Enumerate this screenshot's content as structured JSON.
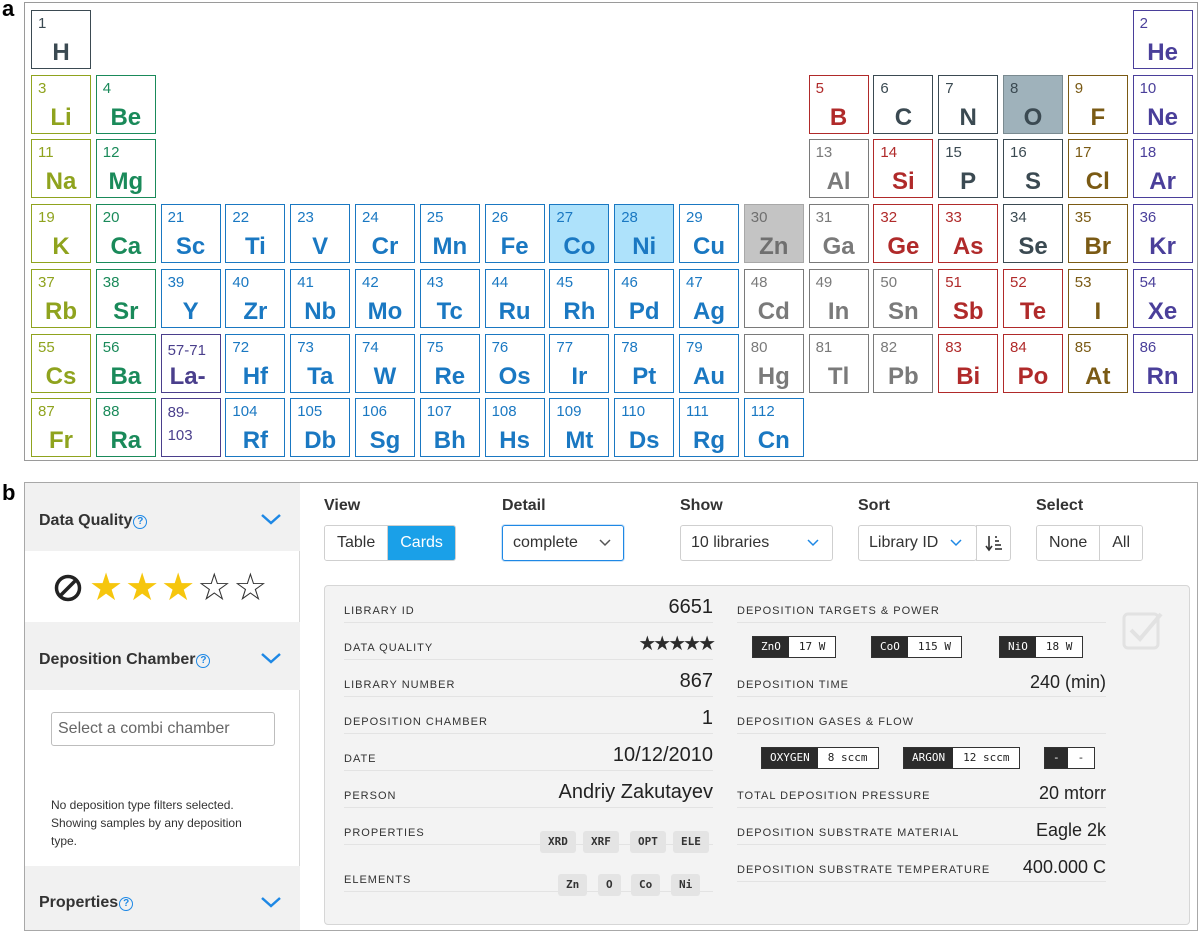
{
  "panel_labels": {
    "a": "a",
    "b": "b"
  },
  "periodic_table": {
    "colors": {
      "alkali": "#8fa31e",
      "alkaline": "#1a8a5a",
      "transition": "#1a78c2",
      "lanthanide": "#4a3f8c",
      "metalloid": "#b02a2a",
      "nonmetal": "#3b4a52",
      "halogen": "#7a5a14",
      "noble": "#4a3f9a",
      "post": "#7a7a7a"
    },
    "elements": [
      {
        "n": "1",
        "s": "H",
        "c": "nonmetal",
        "col": 0,
        "row": 0
      },
      {
        "n": "2",
        "s": "He",
        "c": "noble",
        "col": 17,
        "row": 0
      },
      {
        "n": "3",
        "s": "Li",
        "c": "alkali",
        "col": 0,
        "row": 1
      },
      {
        "n": "4",
        "s": "Be",
        "c": "alkaline",
        "col": 1,
        "row": 1
      },
      {
        "n": "5",
        "s": "B",
        "c": "metalloid",
        "col": 12,
        "row": 1
      },
      {
        "n": "6",
        "s": "C",
        "c": "nonmetal",
        "col": 13,
        "row": 1
      },
      {
        "n": "7",
        "s": "N",
        "c": "nonmetal",
        "col": 14,
        "row": 1
      },
      {
        "n": "8",
        "s": "O",
        "c": "nonmetal",
        "col": 15,
        "row": 1,
        "sel": "dark"
      },
      {
        "n": "9",
        "s": "F",
        "c": "halogen",
        "col": 16,
        "row": 1
      },
      {
        "n": "10",
        "s": "Ne",
        "c": "noble",
        "col": 17,
        "row": 1
      },
      {
        "n": "11",
        "s": "Na",
        "c": "alkali",
        "col": 0,
        "row": 2
      },
      {
        "n": "12",
        "s": "Mg",
        "c": "alkaline",
        "col": 1,
        "row": 2
      },
      {
        "n": "13",
        "s": "Al",
        "c": "post",
        "col": 12,
        "row": 2
      },
      {
        "n": "14",
        "s": "Si",
        "c": "metalloid",
        "col": 13,
        "row": 2
      },
      {
        "n": "15",
        "s": "P",
        "c": "nonmetal",
        "col": 14,
        "row": 2
      },
      {
        "n": "16",
        "s": "S",
        "c": "nonmetal",
        "col": 15,
        "row": 2
      },
      {
        "n": "17",
        "s": "Cl",
        "c": "halogen",
        "col": 16,
        "row": 2
      },
      {
        "n": "18",
        "s": "Ar",
        "c": "noble",
        "col": 17,
        "row": 2
      },
      {
        "n": "19",
        "s": "K",
        "c": "alkali",
        "col": 0,
        "row": 3
      },
      {
        "n": "20",
        "s": "Ca",
        "c": "alkaline",
        "col": 1,
        "row": 3
      },
      {
        "n": "21",
        "s": "Sc",
        "c": "transition",
        "col": 2,
        "row": 3
      },
      {
        "n": "22",
        "s": "Ti",
        "c": "transition",
        "col": 3,
        "row": 3
      },
      {
        "n": "23",
        "s": "V",
        "c": "transition",
        "col": 4,
        "row": 3
      },
      {
        "n": "24",
        "s": "Cr",
        "c": "transition",
        "col": 5,
        "row": 3
      },
      {
        "n": "25",
        "s": "Mn",
        "c": "transition",
        "col": 6,
        "row": 3
      },
      {
        "n": "26",
        "s": "Fe",
        "c": "transition",
        "col": 7,
        "row": 3
      },
      {
        "n": "27",
        "s": "Co",
        "c": "transition",
        "col": 8,
        "row": 3,
        "sel": "blue"
      },
      {
        "n": "28",
        "s": "Ni",
        "c": "transition",
        "col": 9,
        "row": 3,
        "sel": "blue"
      },
      {
        "n": "29",
        "s": "Cu",
        "c": "transition",
        "col": 10,
        "row": 3
      },
      {
        "n": "30",
        "s": "Zn",
        "c": "post",
        "col": 11,
        "row": 3,
        "sel": "gray"
      },
      {
        "n": "31",
        "s": "Ga",
        "c": "post",
        "col": 12,
        "row": 3
      },
      {
        "n": "32",
        "s": "Ge",
        "c": "metalloid",
        "col": 13,
        "row": 3
      },
      {
        "n": "33",
        "s": "As",
        "c": "metalloid",
        "col": 14,
        "row": 3
      },
      {
        "n": "34",
        "s": "Se",
        "c": "nonmetal",
        "col": 15,
        "row": 3
      },
      {
        "n": "35",
        "s": "Br",
        "c": "halogen",
        "col": 16,
        "row": 3
      },
      {
        "n": "36",
        "s": "Kr",
        "c": "noble",
        "col": 17,
        "row": 3
      },
      {
        "n": "37",
        "s": "Rb",
        "c": "alkali",
        "col": 0,
        "row": 4
      },
      {
        "n": "38",
        "s": "Sr",
        "c": "alkaline",
        "col": 1,
        "row": 4
      },
      {
        "n": "39",
        "s": "Y",
        "c": "transition",
        "col": 2,
        "row": 4
      },
      {
        "n": "40",
        "s": "Zr",
        "c": "transition",
        "col": 3,
        "row": 4
      },
      {
        "n": "41",
        "s": "Nb",
        "c": "transition",
        "col": 4,
        "row": 4
      },
      {
        "n": "42",
        "s": "Mo",
        "c": "transition",
        "col": 5,
        "row": 4
      },
      {
        "n": "43",
        "s": "Tc",
        "c": "transition",
        "col": 6,
        "row": 4
      },
      {
        "n": "44",
        "s": "Ru",
        "c": "transition",
        "col": 7,
        "row": 4
      },
      {
        "n": "45",
        "s": "Rh",
        "c": "transition",
        "col": 8,
        "row": 4
      },
      {
        "n": "46",
        "s": "Pd",
        "c": "transition",
        "col": 9,
        "row": 4
      },
      {
        "n": "47",
        "s": "Ag",
        "c": "transition",
        "col": 10,
        "row": 4
      },
      {
        "n": "48",
        "s": "Cd",
        "c": "post",
        "col": 11,
        "row": 4
      },
      {
        "n": "49",
        "s": "In",
        "c": "post",
        "col": 12,
        "row": 4
      },
      {
        "n": "50",
        "s": "Sn",
        "c": "post",
        "col": 13,
        "row": 4
      },
      {
        "n": "51",
        "s": "Sb",
        "c": "metalloid",
        "col": 14,
        "row": 4
      },
      {
        "n": "52",
        "s": "Te",
        "c": "metalloid",
        "col": 15,
        "row": 4
      },
      {
        "n": "53",
        "s": "I",
        "c": "halogen",
        "col": 16,
        "row": 4
      },
      {
        "n": "54",
        "s": "Xe",
        "c": "noble",
        "col": 17,
        "row": 4
      },
      {
        "n": "55",
        "s": "Cs",
        "c": "alkali",
        "col": 0,
        "row": 5
      },
      {
        "n": "56",
        "s": "Ba",
        "c": "alkaline",
        "col": 1,
        "row": 5
      },
      {
        "n": "57-71",
        "s": "La-",
        "c": "lanthanide",
        "col": 2,
        "row": 5,
        "range": true
      },
      {
        "n": "72",
        "s": "Hf",
        "c": "transition",
        "col": 3,
        "row": 5
      },
      {
        "n": "73",
        "s": "Ta",
        "c": "transition",
        "col": 4,
        "row": 5
      },
      {
        "n": "74",
        "s": "W",
        "c": "transition",
        "col": 5,
        "row": 5
      },
      {
        "n": "75",
        "s": "Re",
        "c": "transition",
        "col": 6,
        "row": 5
      },
      {
        "n": "76",
        "s": "Os",
        "c": "transition",
        "col": 7,
        "row": 5
      },
      {
        "n": "77",
        "s": "Ir",
        "c": "transition",
        "col": 8,
        "row": 5
      },
      {
        "n": "78",
        "s": "Pt",
        "c": "transition",
        "col": 9,
        "row": 5
      },
      {
        "n": "79",
        "s": "Au",
        "c": "transition",
        "col": 10,
        "row": 5
      },
      {
        "n": "80",
        "s": "Hg",
        "c": "post",
        "col": 11,
        "row": 5
      },
      {
        "n": "81",
        "s": "Tl",
        "c": "post",
        "col": 12,
        "row": 5
      },
      {
        "n": "82",
        "s": "Pb",
        "c": "post",
        "col": 13,
        "row": 5
      },
      {
        "n": "83",
        "s": "Bi",
        "c": "metalloid",
        "col": 14,
        "row": 5
      },
      {
        "n": "84",
        "s": "Po",
        "c": "metalloid",
        "col": 15,
        "row": 5
      },
      {
        "n": "85",
        "s": "At",
        "c": "halogen",
        "col": 16,
        "row": 5
      },
      {
        "n": "86",
        "s": "Rn",
        "c": "noble",
        "col": 17,
        "row": 5
      },
      {
        "n": "87",
        "s": "Fr",
        "c": "alkali",
        "col": 0,
        "row": 6
      },
      {
        "n": "88",
        "s": "Ra",
        "c": "alkaline",
        "col": 1,
        "row": 6
      },
      {
        "n": "89-\n103",
        "s": "",
        "c": "lanthanide",
        "col": 2,
        "row": 6,
        "range": true,
        "two": true
      },
      {
        "n": "104",
        "s": "Rf",
        "c": "transition",
        "col": 3,
        "row": 6
      },
      {
        "n": "105",
        "s": "Db",
        "c": "transition",
        "col": 4,
        "row": 6
      },
      {
        "n": "106",
        "s": "Sg",
        "c": "transition",
        "col": 5,
        "row": 6
      },
      {
        "n": "107",
        "s": "Bh",
        "c": "transition",
        "col": 6,
        "row": 6
      },
      {
        "n": "108",
        "s": "Hs",
        "c": "transition",
        "col": 7,
        "row": 6
      },
      {
        "n": "109",
        "s": "Mt",
        "c": "transition",
        "col": 8,
        "row": 6
      },
      {
        "n": "110",
        "s": "Ds",
        "c": "transition",
        "col": 9,
        "row": 6
      },
      {
        "n": "111",
        "s": "Rg",
        "c": "transition",
        "col": 10,
        "row": 6
      },
      {
        "n": "112",
        "s": "Cn",
        "c": "transition",
        "col": 11,
        "row": 6
      }
    ]
  },
  "sidebar": {
    "data_quality": {
      "title": "Data Quality",
      "help": "?",
      "rating": 3,
      "max": 5
    },
    "deposition_chamber": {
      "title": "Deposition Chamber",
      "help": "?",
      "placeholder": "Select a combi chamber",
      "note": "No deposition type filters selected. Showing samples by any deposition type."
    },
    "properties": {
      "title": "Properties",
      "help": "?"
    }
  },
  "toolbar": {
    "view": {
      "label": "View",
      "options": [
        "Table",
        "Cards"
      ],
      "active": "Cards"
    },
    "detail": {
      "label": "Detail",
      "value": "complete"
    },
    "show": {
      "label": "Show",
      "value": "10 libraries"
    },
    "sort": {
      "label": "Sort",
      "value": "Library ID"
    },
    "select": {
      "label": "Select",
      "options": [
        "None",
        "All"
      ]
    }
  },
  "card": {
    "left": [
      {
        "key": "LIBRARY ID",
        "value": "6651"
      },
      {
        "key": "DATA QUALITY",
        "value": "★★★★★"
      },
      {
        "key": "LIBRARY NUMBER",
        "value": "867"
      },
      {
        "key": "DEPOSITION CHAMBER",
        "value": "1"
      },
      {
        "key": "DATE",
        "value": "10/12/2010"
      },
      {
        "key": "PERSON",
        "value": "Andriy Zakutayev"
      },
      {
        "key": "PROPERTIES",
        "value": ""
      },
      {
        "key": "ELEMENTS",
        "value": ""
      }
    ],
    "properties": [
      "XRD",
      "XRF",
      "OPT",
      "ELE"
    ],
    "elements": [
      "Zn",
      "O",
      "Co",
      "Ni"
    ],
    "targets_title": "DEPOSITION TARGETS & POWER",
    "targets": [
      {
        "material": "ZnO",
        "power": "17 W"
      },
      {
        "material": "CoO",
        "power": "115 W"
      },
      {
        "material": "NiO",
        "power": "18 W"
      }
    ],
    "time": {
      "key": "DEPOSITION TIME",
      "value": "240 (min)"
    },
    "gases_title": "DEPOSITION GASES & FLOW",
    "gases": [
      {
        "gas": "OXYGEN",
        "flow": "8 sccm"
      },
      {
        "gas": "ARGON",
        "flow": "12 sccm"
      },
      {
        "gas": "-",
        "flow": "-"
      }
    ],
    "pressure": {
      "key": "TOTAL DEPOSITION PRESSURE",
      "value": "20 mtorr"
    },
    "substrate": {
      "key": "DEPOSITION SUBSTRATE MATERIAL",
      "value": "Eagle 2k"
    },
    "temperature": {
      "key": "DEPOSITION SUBSTRATE TEMPERATURE",
      "value": "400.000 C"
    }
  }
}
